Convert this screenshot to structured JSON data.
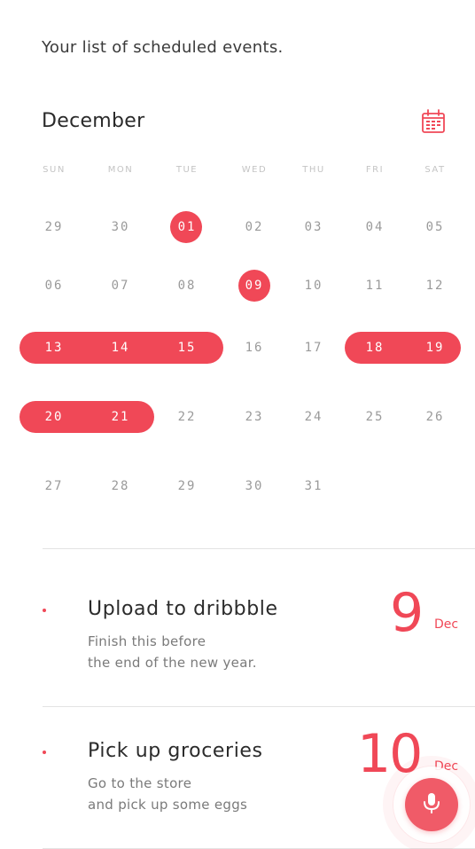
{
  "header": {
    "subtitle": "Your list of scheduled events."
  },
  "calendar": {
    "month": "December",
    "weekdays": [
      "SUN",
      "MON",
      "TUE",
      "WED",
      "THU",
      "FRI",
      "SAT"
    ],
    "weeks": [
      [
        "29",
        "30",
        "01",
        "02",
        "03",
        "04",
        "05"
      ],
      [
        "06",
        "07",
        "08",
        "09",
        "10",
        "11",
        "12"
      ],
      [
        "13",
        "14",
        "15",
        "16",
        "17",
        "18",
        "19"
      ],
      [
        "20",
        "21",
        "22",
        "23",
        "24",
        "25",
        "26"
      ],
      [
        "27",
        "28",
        "29",
        "30",
        "31"
      ]
    ],
    "accent_color": "#f04857"
  },
  "events": [
    {
      "title": "Upload to dribbble",
      "description_line1": "Finish this before",
      "description_line2": "the end of the new year.",
      "day": "9",
      "month": "Dec"
    },
    {
      "title": "Pick up groceries",
      "description_line1": "Go to the store",
      "description_line2": "and pick up some eggs",
      "day": "10",
      "month": "Dec"
    }
  ],
  "fab": {
    "icon": "microphone-icon"
  }
}
